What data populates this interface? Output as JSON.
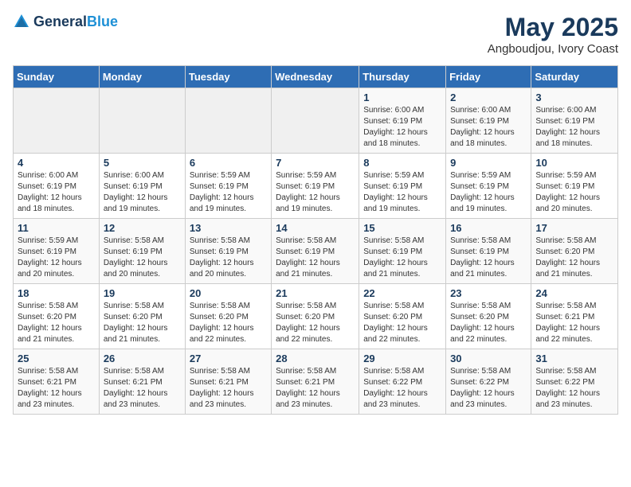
{
  "logo": {
    "general": "General",
    "blue": "Blue"
  },
  "header": {
    "month_year": "May 2025",
    "location": "Angboudjou, Ivory Coast"
  },
  "weekdays": [
    "Sunday",
    "Monday",
    "Tuesday",
    "Wednesday",
    "Thursday",
    "Friday",
    "Saturday"
  ],
  "weeks": [
    [
      {
        "day": "",
        "info": ""
      },
      {
        "day": "",
        "info": ""
      },
      {
        "day": "",
        "info": ""
      },
      {
        "day": "",
        "info": ""
      },
      {
        "day": "1",
        "info": "Sunrise: 6:00 AM\nSunset: 6:19 PM\nDaylight: 12 hours\nand 18 minutes."
      },
      {
        "day": "2",
        "info": "Sunrise: 6:00 AM\nSunset: 6:19 PM\nDaylight: 12 hours\nand 18 minutes."
      },
      {
        "day": "3",
        "info": "Sunrise: 6:00 AM\nSunset: 6:19 PM\nDaylight: 12 hours\nand 18 minutes."
      }
    ],
    [
      {
        "day": "4",
        "info": "Sunrise: 6:00 AM\nSunset: 6:19 PM\nDaylight: 12 hours\nand 18 minutes."
      },
      {
        "day": "5",
        "info": "Sunrise: 6:00 AM\nSunset: 6:19 PM\nDaylight: 12 hours\nand 19 minutes."
      },
      {
        "day": "6",
        "info": "Sunrise: 5:59 AM\nSunset: 6:19 PM\nDaylight: 12 hours\nand 19 minutes."
      },
      {
        "day": "7",
        "info": "Sunrise: 5:59 AM\nSunset: 6:19 PM\nDaylight: 12 hours\nand 19 minutes."
      },
      {
        "day": "8",
        "info": "Sunrise: 5:59 AM\nSunset: 6:19 PM\nDaylight: 12 hours\nand 19 minutes."
      },
      {
        "day": "9",
        "info": "Sunrise: 5:59 AM\nSunset: 6:19 PM\nDaylight: 12 hours\nand 19 minutes."
      },
      {
        "day": "10",
        "info": "Sunrise: 5:59 AM\nSunset: 6:19 PM\nDaylight: 12 hours\nand 20 minutes."
      }
    ],
    [
      {
        "day": "11",
        "info": "Sunrise: 5:59 AM\nSunset: 6:19 PM\nDaylight: 12 hours\nand 20 minutes."
      },
      {
        "day": "12",
        "info": "Sunrise: 5:58 AM\nSunset: 6:19 PM\nDaylight: 12 hours\nand 20 minutes."
      },
      {
        "day": "13",
        "info": "Sunrise: 5:58 AM\nSunset: 6:19 PM\nDaylight: 12 hours\nand 20 minutes."
      },
      {
        "day": "14",
        "info": "Sunrise: 5:58 AM\nSunset: 6:19 PM\nDaylight: 12 hours\nand 21 minutes."
      },
      {
        "day": "15",
        "info": "Sunrise: 5:58 AM\nSunset: 6:19 PM\nDaylight: 12 hours\nand 21 minutes."
      },
      {
        "day": "16",
        "info": "Sunrise: 5:58 AM\nSunset: 6:19 PM\nDaylight: 12 hours\nand 21 minutes."
      },
      {
        "day": "17",
        "info": "Sunrise: 5:58 AM\nSunset: 6:20 PM\nDaylight: 12 hours\nand 21 minutes."
      }
    ],
    [
      {
        "day": "18",
        "info": "Sunrise: 5:58 AM\nSunset: 6:20 PM\nDaylight: 12 hours\nand 21 minutes."
      },
      {
        "day": "19",
        "info": "Sunrise: 5:58 AM\nSunset: 6:20 PM\nDaylight: 12 hours\nand 21 minutes."
      },
      {
        "day": "20",
        "info": "Sunrise: 5:58 AM\nSunset: 6:20 PM\nDaylight: 12 hours\nand 22 minutes."
      },
      {
        "day": "21",
        "info": "Sunrise: 5:58 AM\nSunset: 6:20 PM\nDaylight: 12 hours\nand 22 minutes."
      },
      {
        "day": "22",
        "info": "Sunrise: 5:58 AM\nSunset: 6:20 PM\nDaylight: 12 hours\nand 22 minutes."
      },
      {
        "day": "23",
        "info": "Sunrise: 5:58 AM\nSunset: 6:20 PM\nDaylight: 12 hours\nand 22 minutes."
      },
      {
        "day": "24",
        "info": "Sunrise: 5:58 AM\nSunset: 6:21 PM\nDaylight: 12 hours\nand 22 minutes."
      }
    ],
    [
      {
        "day": "25",
        "info": "Sunrise: 5:58 AM\nSunset: 6:21 PM\nDaylight: 12 hours\nand 23 minutes."
      },
      {
        "day": "26",
        "info": "Sunrise: 5:58 AM\nSunset: 6:21 PM\nDaylight: 12 hours\nand 23 minutes."
      },
      {
        "day": "27",
        "info": "Sunrise: 5:58 AM\nSunset: 6:21 PM\nDaylight: 12 hours\nand 23 minutes."
      },
      {
        "day": "28",
        "info": "Sunrise: 5:58 AM\nSunset: 6:21 PM\nDaylight: 12 hours\nand 23 minutes."
      },
      {
        "day": "29",
        "info": "Sunrise: 5:58 AM\nSunset: 6:22 PM\nDaylight: 12 hours\nand 23 minutes."
      },
      {
        "day": "30",
        "info": "Sunrise: 5:58 AM\nSunset: 6:22 PM\nDaylight: 12 hours\nand 23 minutes."
      },
      {
        "day": "31",
        "info": "Sunrise: 5:58 AM\nSunset: 6:22 PM\nDaylight: 12 hours\nand 23 minutes."
      }
    ]
  ]
}
